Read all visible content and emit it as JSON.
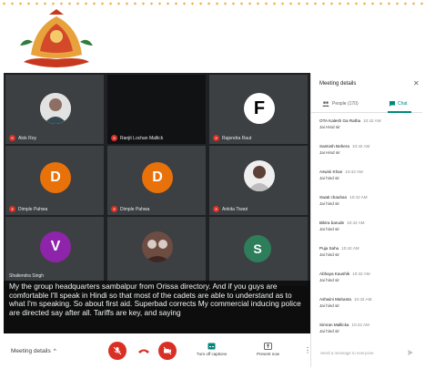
{
  "colors": {
    "accent": "#00897b",
    "danger": "#d93025",
    "stage_bg": "#202124"
  },
  "participants": [
    {
      "name": "Alok Roy",
      "avatar": "photo"
    },
    {
      "name": "Ranjit Lochan Mallick",
      "avatar": "none"
    },
    {
      "name": "Rajendra Raut",
      "avatar": "F"
    },
    {
      "name": "Dimple Pahwa",
      "avatar": "D"
    },
    {
      "name": "Dimple Pahwa",
      "avatar": "D"
    },
    {
      "name": "Ankita Tiwari",
      "avatar": "photo"
    },
    {
      "name": "Shaliendra Singh",
      "avatar": "V"
    },
    {
      "name": "",
      "avatar": "photo"
    },
    {
      "name": "",
      "avatar": "S"
    }
  ],
  "caption": "My the group headquarters sambalpur from Orissa directory. And if you guys are comfortable I'll speak in Hindi so that most of the cadets are able to understand as to what I'm speaking. So about first aid. Superbad corrects My commercial inducing police are directed say after all. Tariffs are key, and saying",
  "bottom_bar": {
    "meeting_details": "Meeting details",
    "captions_label": "Turn off captions",
    "present_label": "Present now"
  },
  "panel": {
    "title": "Meeting details",
    "tab_people": "People (170)",
    "tab_chat": "Chat",
    "messages": [
      {
        "name": "OTA Kalesh Ga Ratha",
        "time": "10:42 AM",
        "text": "Jai Hind sir"
      },
      {
        "name": "Santosh Behera",
        "time": "10:42 AM",
        "text": "Jai Hind sir"
      },
      {
        "name": "Aswini Khan",
        "time": "10:42 AM",
        "text": "Jai hind sir"
      },
      {
        "name": "Swati chauhan",
        "time": "10:42 AM",
        "text": "Jai hind sir"
      },
      {
        "name": "Bikira barude",
        "time": "10:42 AM",
        "text": "Jai hind sir"
      },
      {
        "name": "Puja Sahu",
        "time": "10:42 AM",
        "text": "Jai hind sir"
      },
      {
        "name": "Abhaya Kaushik",
        "time": "10:42 AM",
        "text": "Jai hind sir"
      },
      {
        "name": "Ashwini Mahanta",
        "time": "10:42 AM",
        "text": "Jai hind sir"
      },
      {
        "name": "Simran Mallicka",
        "time": "10:42 AM",
        "text": "Jai hind sir"
      }
    ],
    "send_placeholder": "Send a message to everyone"
  }
}
